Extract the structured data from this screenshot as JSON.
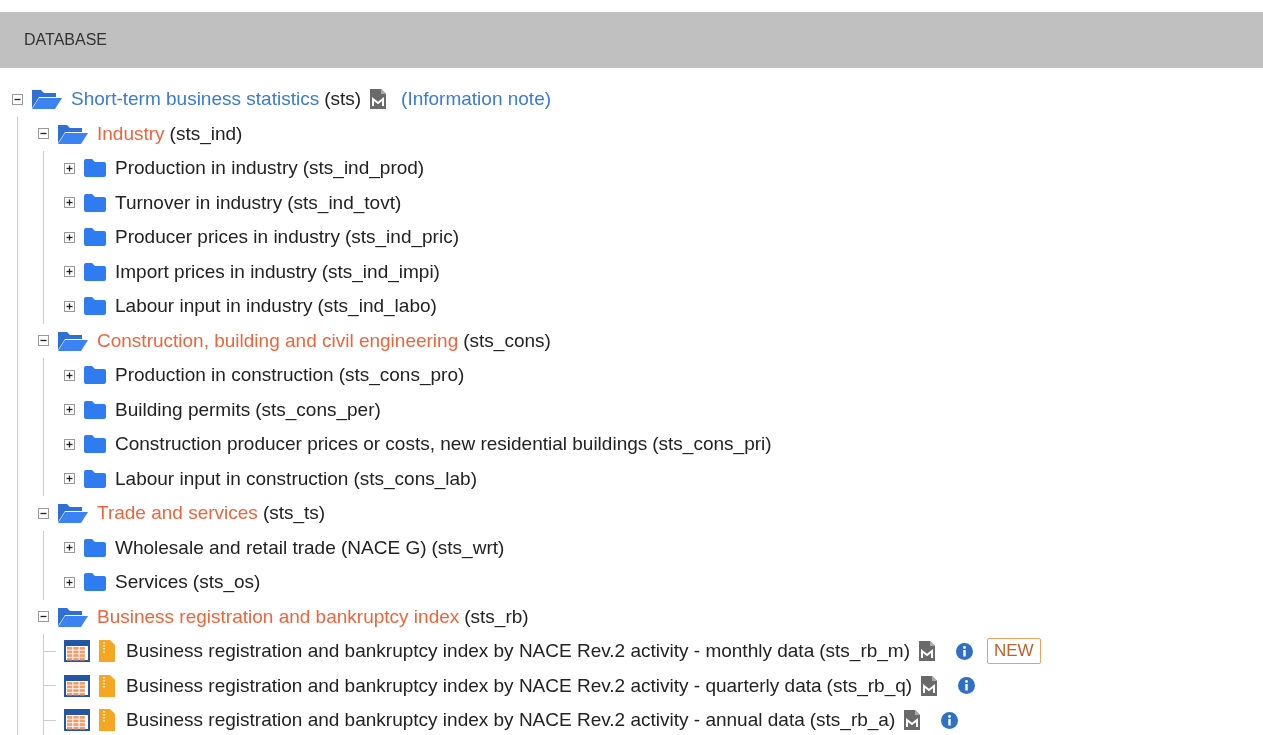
{
  "header": {
    "title": "DATABASE"
  },
  "tree": [
    {
      "kind": "folder",
      "expanded": true,
      "name": "Short-term business statistics",
      "code": "(sts)",
      "metadata": true,
      "link": "(Information note)",
      "children": [
        {
          "kind": "folder",
          "expanded": true,
          "name": "Industry",
          "code": "(sts_ind)",
          "children": [
            {
              "kind": "folder",
              "expanded": false,
              "name": "Production in industry",
              "code": "(sts_ind_prod)"
            },
            {
              "kind": "folder",
              "expanded": false,
              "name": "Turnover in industry",
              "code": "(sts_ind_tovt)"
            },
            {
              "kind": "folder",
              "expanded": false,
              "name": "Producer prices in industry",
              "code": "(sts_ind_pric)"
            },
            {
              "kind": "folder",
              "expanded": false,
              "name": "Import prices in industry",
              "code": "(sts_ind_impi)"
            },
            {
              "kind": "folder",
              "expanded": false,
              "name": "Labour input in industry",
              "code": "(sts_ind_labo)"
            }
          ]
        },
        {
          "kind": "folder",
          "expanded": true,
          "name": "Construction, building and civil engineering",
          "code": "(sts_cons)",
          "children": [
            {
              "kind": "folder",
              "expanded": false,
              "name": "Production in construction",
              "code": "(sts_cons_pro)"
            },
            {
              "kind": "folder",
              "expanded": false,
              "name": "Building permits",
              "code": "(sts_cons_per)"
            },
            {
              "kind": "folder",
              "expanded": false,
              "name": "Construction producer prices or costs, new residential buildings",
              "code": "(sts_cons_pri)"
            },
            {
              "kind": "folder",
              "expanded": false,
              "name": "Labour input in construction",
              "code": "(sts_cons_lab)"
            }
          ]
        },
        {
          "kind": "folder",
          "expanded": true,
          "name": "Trade and services",
          "code": "(sts_ts)",
          "children": [
            {
              "kind": "folder",
              "expanded": false,
              "name": "Wholesale and retail trade (NACE G)",
              "code": "(sts_wrt)"
            },
            {
              "kind": "folder",
              "expanded": false,
              "name": "Services",
              "code": "(sts_os)"
            }
          ]
        },
        {
          "kind": "folder",
          "expanded": true,
          "name": "Business registration and bankruptcy index",
          "code": "(sts_rb)",
          "children": [
            {
              "kind": "dataset",
              "name": "Business registration and bankruptcy index by NACE Rev.2 activity - monthly data",
              "code": "(sts_rb_m)",
              "metadata": true,
              "info": true,
              "badge": "NEW"
            },
            {
              "kind": "dataset",
              "name": "Business registration and bankruptcy index by NACE Rev.2 activity - quarterly data",
              "code": "(sts_rb_q)",
              "metadata": true,
              "info": true
            },
            {
              "kind": "dataset",
              "name": "Business registration and bankruptcy index by NACE Rev.2 activity - annual data",
              "code": "(sts_rb_a)",
              "metadata": true,
              "info": true
            }
          ]
        }
      ]
    }
  ]
}
